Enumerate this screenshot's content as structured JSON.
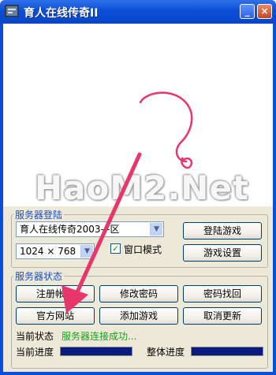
{
  "window": {
    "title": "育人在线传奇II",
    "min_glyph": "_",
    "close_glyph": "×"
  },
  "watermark": "HaoM2.Net",
  "login_group": {
    "legend": "服务器登陆",
    "server_select": "育人在线传奇2003—区",
    "resolution_select": "1024 × 768",
    "window_mode_label": "窗口模式",
    "window_mode_checked": true,
    "login_button": "登陆游戏",
    "settings_button": "游戏设置"
  },
  "status_group": {
    "legend": "服务器状态",
    "buttons": {
      "register": "注册帐号",
      "change_password": "修改密码",
      "recover_password": "密码找回",
      "official_site": "官方网站",
      "add_game": "添加游戏",
      "cancel_update": "取消更新"
    },
    "status_label": "当前状态",
    "status_value": "服务器连接成功...",
    "current_progress_label": "当前进度",
    "overall_progress_label": "整体进度",
    "current_progress": 1.0,
    "overall_progress": 1.0
  },
  "icons": {
    "app": "app-icon",
    "dropdown": "dropdown-arrow-icon",
    "check": "checkmark-icon"
  },
  "colors": {
    "titlebar": "#0b4fd8",
    "legend": "#1f4fbf",
    "status_ok": "#1aa01a",
    "progress": "#0a1b7e",
    "annotation": "#e8356a"
  }
}
